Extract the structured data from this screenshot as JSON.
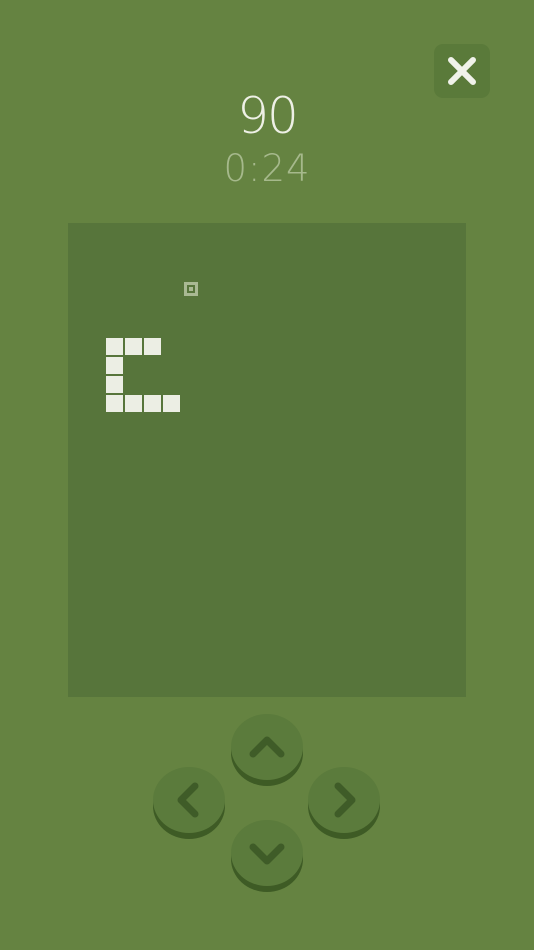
{
  "game": {
    "score": "90",
    "timer": "0:24"
  },
  "icons": {
    "close": "close-icon",
    "up": "chevron-up-icon",
    "down": "chevron-down-icon",
    "left": "chevron-left-icon",
    "right": "chevron-right-icon"
  },
  "colors": {
    "background": "#658341",
    "board": "#57753b",
    "snake": "#eceee4",
    "food": "#a9b993",
    "button": "#5b7b3c",
    "button_shadow": "#3e5b25",
    "arrow": "#3f5c28"
  }
}
